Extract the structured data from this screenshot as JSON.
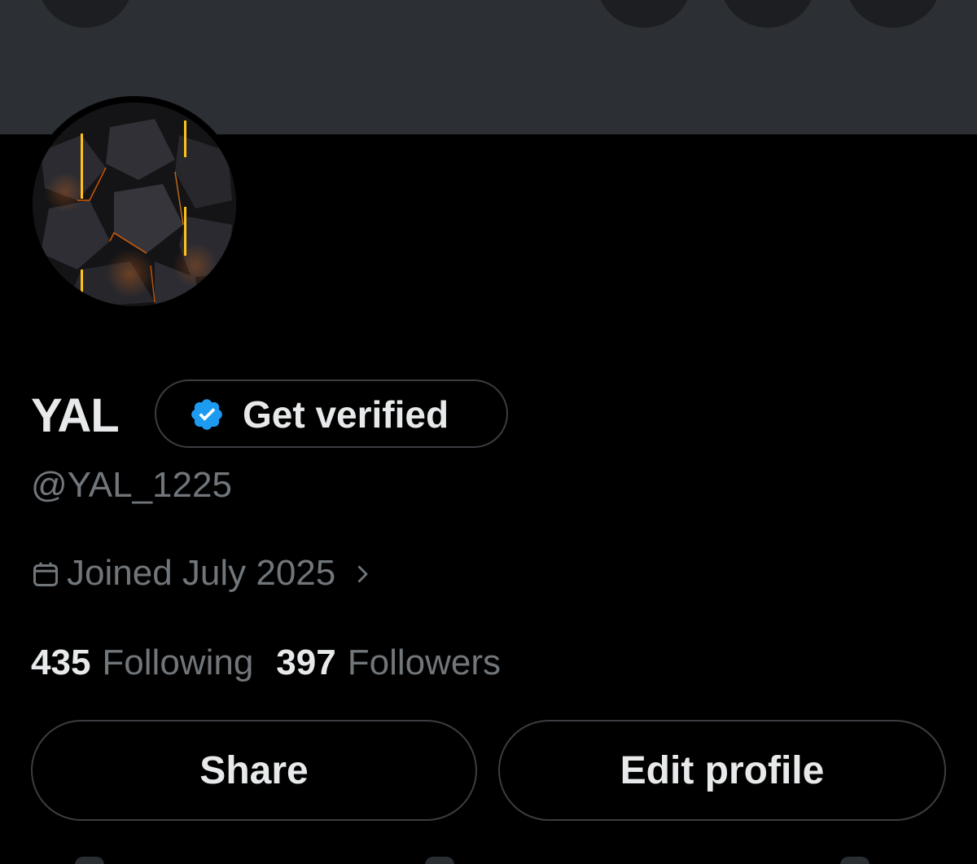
{
  "profile": {
    "display_name": "YAL",
    "handle": "@YAL_1225",
    "joined": "Joined July 2025",
    "following_count": "435",
    "following_label": "Following",
    "followers_count": "397",
    "followers_label": "Followers"
  },
  "verify": {
    "label": "Get verified"
  },
  "actions": {
    "share_label": "Share",
    "edit_label": "Edit profile"
  },
  "icons": {
    "verified_badge": "verified-badge-icon",
    "calendar": "calendar-icon",
    "chevron": "chevron-right-icon"
  },
  "colors": {
    "background": "#000000",
    "banner": "#2c2f33",
    "text_primary": "#e7e9ea",
    "text_secondary": "#71767b",
    "verified_blue": "#1d9bf0",
    "border": "#3a3d41"
  }
}
